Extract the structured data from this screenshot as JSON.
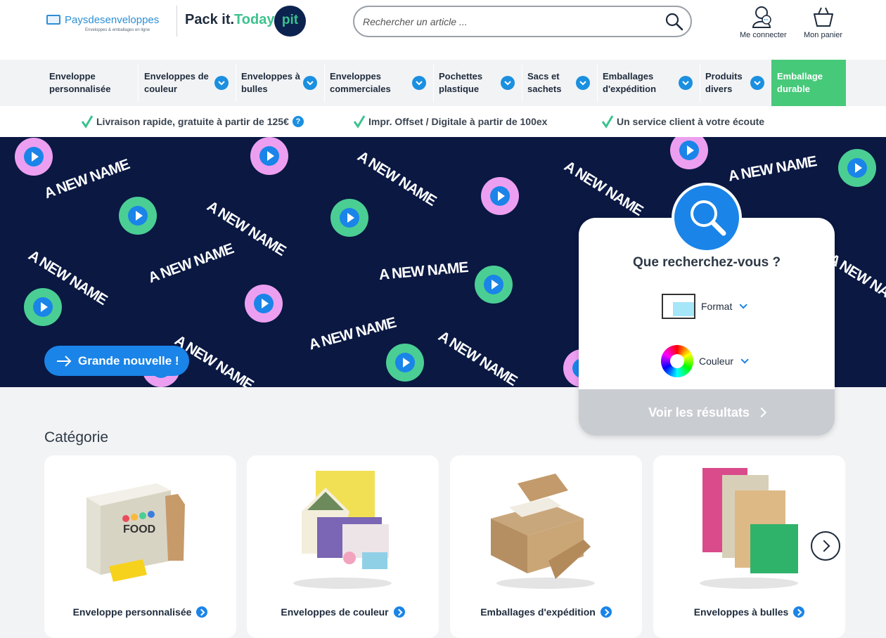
{
  "header": {
    "logo_main": "Paysdesenveloppes",
    "logo_sub": "Enveloppes & emballages en ligne",
    "logo_partner_a": "Pack it.",
    "logo_partner_b": "Today.",
    "logo_badge": "pit",
    "search_placeholder": "Rechercher un article ...",
    "login_label": "Me connecter",
    "cart_label": "Mon panier"
  },
  "nav": {
    "items": [
      {
        "label": "Enveloppe\npersonnalisée",
        "has_menu": false
      },
      {
        "label": "Enveloppes de\ncouleur",
        "has_menu": true
      },
      {
        "label": "Enveloppes à\nbulles",
        "has_menu": true
      },
      {
        "label": "Enveloppes\ncommerciales",
        "has_menu": true
      },
      {
        "label": "Pochettes\nplastique",
        "has_menu": true
      },
      {
        "label": "Sacs et\nsachets",
        "has_menu": true
      },
      {
        "label": "Emballages\nd'expédition",
        "has_menu": true
      },
      {
        "label": "Produits\ndivers",
        "has_menu": true
      },
      {
        "label": "Emballage\ndurable",
        "has_menu": false
      }
    ]
  },
  "benefits": {
    "b1": "Livraison rapide, gratuite à partir de 125€",
    "b1_help": "?",
    "b2": "Impr. Offset / Digitale à partir de 100ex",
    "b3": "Un service client à votre écoute"
  },
  "hero": {
    "pattern_text": "A NEW NAME",
    "cta_label": "Grande nouvelle !"
  },
  "finder": {
    "title": "Que recherchez-vous ?",
    "format_label": "Format",
    "color_label": "Couleur",
    "submit_label": "Voir les résultats"
  },
  "categories": {
    "title": "Catégorie",
    "items": [
      {
        "label": "Enveloppe personnalisée"
      },
      {
        "label": "Enveloppes de couleur"
      },
      {
        "label": "Emballages d'expédition"
      },
      {
        "label": "Enveloppes à bulles"
      }
    ]
  },
  "colors": {
    "accent": "#1a84e8",
    "nav_green": "#47c97a",
    "hero_bg": "#0a1842",
    "brand_green": "#3cc28e"
  },
  "icons": [
    "search-icon",
    "user-icon",
    "basket-icon",
    "chevron-down-icon",
    "check-icon",
    "help-icon",
    "play-icon",
    "arrow-right-icon",
    "magnifier-icon",
    "chevron-right-icon"
  ]
}
